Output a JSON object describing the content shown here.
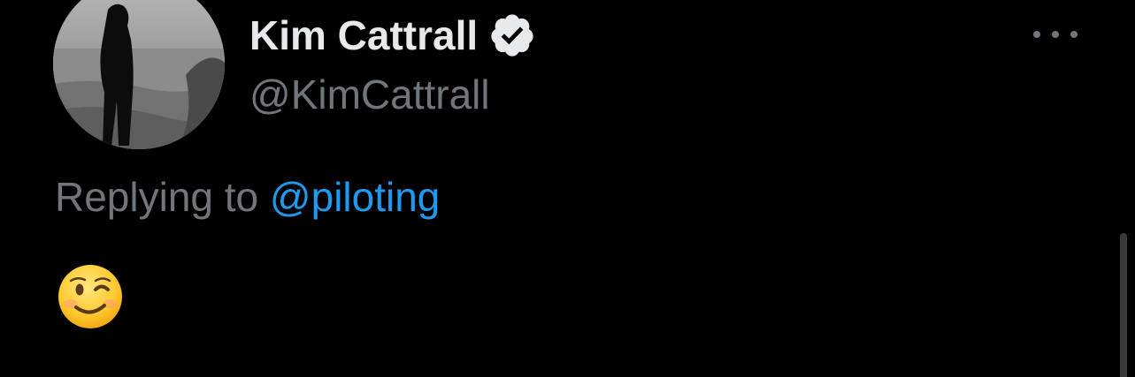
{
  "tweet": {
    "author": {
      "display_name": "Kim Cattrall",
      "handle": "@KimCattrall",
      "verified": true,
      "avatar": "profile-photo-beach-silhouette"
    },
    "reply_context": {
      "prefix": "Replying to",
      "mention": "@piloting"
    },
    "content": {
      "emoji": "winking-face"
    },
    "more_icon": "more-horizontal-icon"
  },
  "colors": {
    "background": "#000000",
    "primary_text": "#e7e9ea",
    "secondary_text": "#71767b",
    "link": "#1d9bf0"
  }
}
